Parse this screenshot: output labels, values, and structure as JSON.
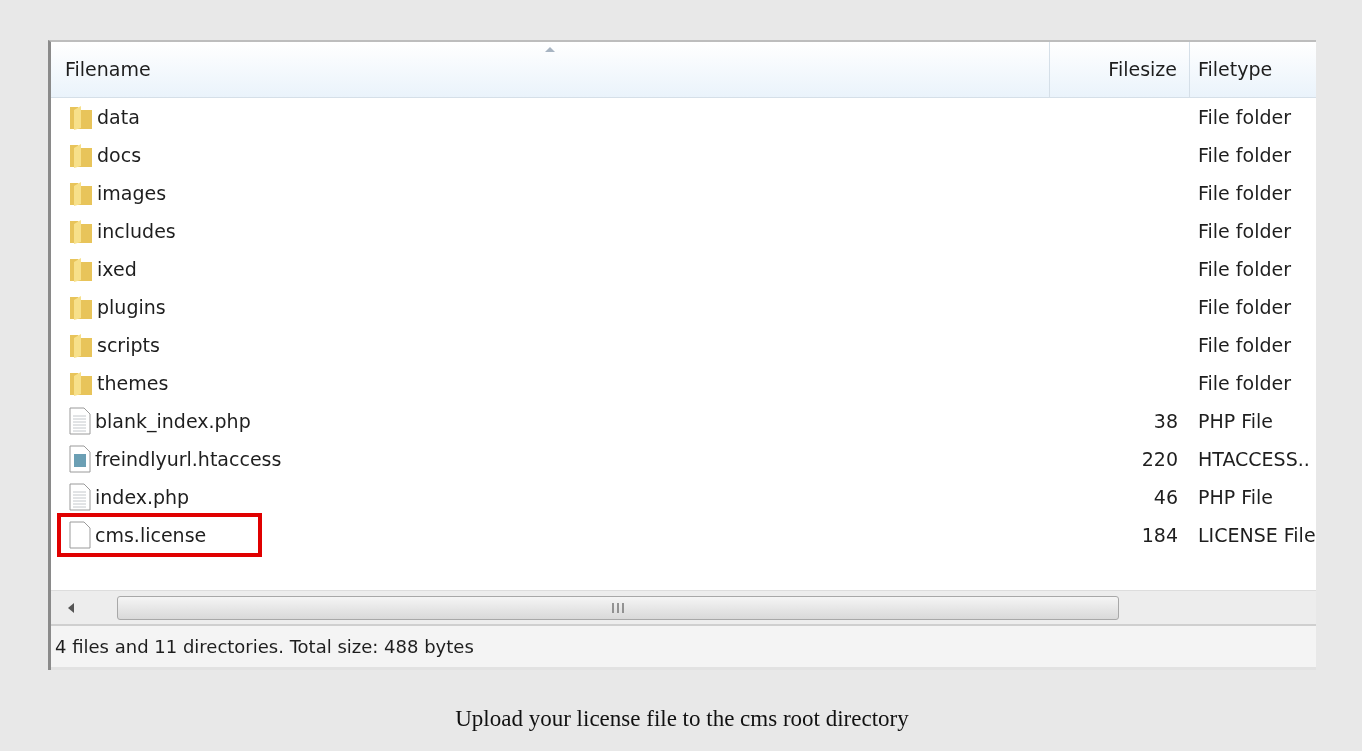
{
  "table": {
    "columns": [
      {
        "label": "Filename",
        "sorted": true
      },
      {
        "label": "Filesize",
        "sorted": false
      },
      {
        "label": "Filetype",
        "sorted": false
      }
    ],
    "rows": [
      {
        "kind": "folder",
        "name": "data",
        "size": "",
        "type": "File folder",
        "highlighted": false
      },
      {
        "kind": "folder",
        "name": "docs",
        "size": "",
        "type": "File folder",
        "highlighted": false
      },
      {
        "kind": "folder",
        "name": "images",
        "size": "",
        "type": "File folder",
        "highlighted": false
      },
      {
        "kind": "folder",
        "name": "includes",
        "size": "",
        "type": "File folder",
        "highlighted": false
      },
      {
        "kind": "folder",
        "name": "ixed",
        "size": "",
        "type": "File folder",
        "highlighted": false
      },
      {
        "kind": "folder",
        "name": "plugins",
        "size": "",
        "type": "File folder",
        "highlighted": false
      },
      {
        "kind": "folder",
        "name": "scripts",
        "size": "",
        "type": "File folder",
        "highlighted": false
      },
      {
        "kind": "folder",
        "name": "themes",
        "size": "",
        "type": "File folder",
        "highlighted": false
      },
      {
        "kind": "text",
        "name": "blank_index.php",
        "size": "38",
        "type": "PHP File",
        "highlighted": false
      },
      {
        "kind": "config",
        "name": "freindlyurl.htaccess",
        "size": "220",
        "type": "HTACCESS..",
        "highlighted": false
      },
      {
        "kind": "text",
        "name": "index.php",
        "size": "46",
        "type": "PHP File",
        "highlighted": false
      },
      {
        "kind": "blank",
        "name": "cms.license",
        "size": "184",
        "type": "LICENSE File",
        "highlighted": true
      }
    ]
  },
  "status_bar": "4 files and 11 directories. Total size: 488 bytes",
  "caption": "Upload your license file to the cms root directory"
}
